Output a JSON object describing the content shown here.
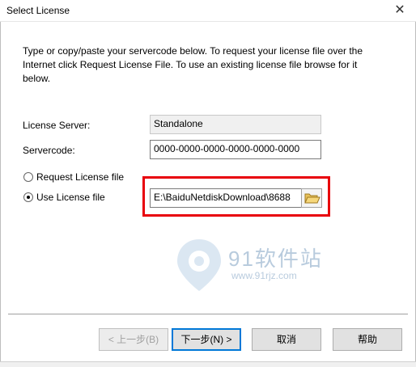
{
  "window": {
    "title": "Select License",
    "close_glyph": "✕"
  },
  "description": "Type or copy/paste your servercode below. To request your license file over the Internet click Request License File. To use an existing license file browse for it below.",
  "license_server": {
    "label": "License Server:",
    "value": "Standalone"
  },
  "servercode": {
    "label": "Servercode:",
    "value": "0000-0000-0000-0000-0000-0000"
  },
  "options": [
    {
      "label": "Request License file",
      "selected": false
    },
    {
      "label": "Use License file",
      "selected": true
    }
  ],
  "license_file_path": "E:\\BaiduNetdiskDownload\\8688",
  "watermark": {
    "text": "91软件站",
    "url": "www.91rjz.com"
  },
  "buttons": {
    "back": "< 上一步(B)",
    "next": "下一步(N) >",
    "cancel": "取消",
    "help": "帮助"
  },
  "colors": {
    "highlight_border": "#e8000b",
    "default_button_border": "#0078d7"
  }
}
